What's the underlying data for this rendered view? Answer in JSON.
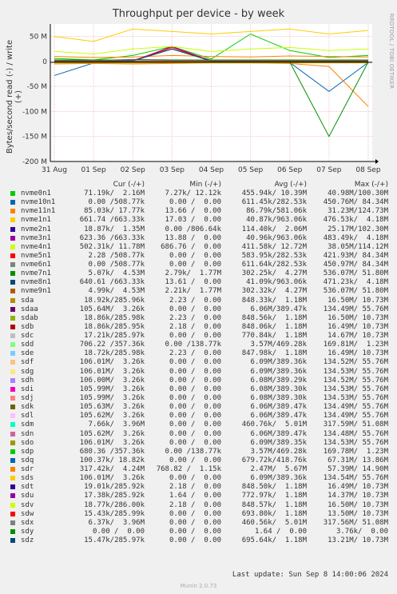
{
  "title": "Throughput per device - by week",
  "ylabel": "Bytes/second read (-) / write (+)",
  "side_label": "RRDTOOL / TOBI OETIKER",
  "footer": "Last update:  Sun Sep  8 14:00:06 2024",
  "version": "Munin 2.0.73",
  "legend_headers": {
    "cur": "Cur (-/+)",
    "min": "Min (-/+)",
    "avg": "Avg (-/+)",
    "max": "Max (-/+)"
  },
  "chart_data": {
    "type": "line",
    "title": "Throughput per device - by week",
    "ylabel": "Bytes/second read (-) / write (+)",
    "ylim": [
      -200,
      75
    ],
    "yunit": "M",
    "yticks": [
      "50 M",
      "0",
      "-50 M",
      "-100 M",
      "-150 M",
      "-200 M"
    ],
    "ytick_values": [
      50,
      0,
      -50,
      -100,
      -150,
      -200
    ],
    "xticks": [
      "31 Aug",
      "01 Sep",
      "02 Sep",
      "03 Sep",
      "04 Sep",
      "05 Sep",
      "06 Sep",
      "07 Sep",
      "08 Sep"
    ],
    "grid": true,
    "x": [
      "31 Aug",
      "01 Sep",
      "02 Sep",
      "03 Sep",
      "04 Sep",
      "05 Sep",
      "06 Sep",
      "07 Sep",
      "08 Sep"
    ],
    "series": [
      {
        "name": "nvme0n1",
        "color": "#00cc00",
        "values": [
          6,
          3,
          12,
          30,
          5,
          55,
          22,
          8,
          12
        ],
        "read": [
          -1,
          -1,
          -1,
          -1,
          -1,
          -2,
          -1,
          -2,
          -1
        ]
      },
      {
        "name": "nvme10n1",
        "color": "#0066b3",
        "values": [
          3,
          2,
          4,
          3,
          2,
          3,
          2,
          3,
          2
        ],
        "read": [
          -28,
          -3,
          -2,
          -2,
          -2,
          -2,
          -2,
          -60,
          -2
        ]
      },
      {
        "name": "nvme11n1",
        "color": "#ff8000",
        "values": [
          10,
          8,
          9,
          12,
          10,
          9,
          11,
          10,
          9
        ],
        "read": [
          -5,
          -4,
          -5,
          -4,
          -3,
          -3,
          -4,
          -10,
          -90
        ]
      },
      {
        "name": "nvme1n1",
        "color": "#ffcc00",
        "values": [
          50,
          40,
          65,
          60,
          55,
          60,
          65,
          55,
          62
        ],
        "read": [
          -3,
          -3,
          -3,
          -3,
          -3,
          -3,
          -3,
          -3,
          -3
        ]
      },
      {
        "name": "nvme2n1",
        "color": "#330099",
        "values": [
          2,
          1,
          2,
          25,
          2,
          2,
          2,
          2,
          2
        ],
        "read": [
          -1,
          -1,
          -1,
          -1,
          -1,
          -1,
          -1,
          -1,
          -1
        ]
      },
      {
        "name": "nvme3n1",
        "color": "#990099",
        "values": [
          1,
          1,
          1,
          30,
          1,
          1,
          1,
          1,
          1
        ],
        "read": [
          0,
          0,
          0,
          0,
          0,
          0,
          0,
          0,
          0
        ]
      },
      {
        "name": "nvme4n1",
        "color": "#ccff00",
        "values": [
          20,
          15,
          25,
          30,
          20,
          25,
          28,
          22,
          25
        ],
        "read": [
          -2,
          -2,
          -2,
          -2,
          -2,
          -2,
          -2,
          -2,
          -2
        ]
      },
      {
        "name": "nvme5n1",
        "color": "#ff0000",
        "values": [
          1,
          1,
          1,
          28,
          1,
          1,
          1,
          1,
          1
        ],
        "read": [
          0,
          0,
          0,
          0,
          0,
          0,
          0,
          0,
          0
        ]
      },
      {
        "name": "nvme6n1",
        "color": "#808080",
        "values": [
          1,
          1,
          1,
          25,
          1,
          1,
          1,
          1,
          1
        ],
        "read": [
          0,
          0,
          0,
          0,
          0,
          0,
          0,
          0,
          0
        ]
      },
      {
        "name": "nvme7n1",
        "color": "#008f00",
        "values": [
          3,
          3,
          3,
          3,
          3,
          3,
          3,
          3,
          3
        ],
        "read": [
          -1,
          -1,
          -1,
          -1,
          -1,
          -1,
          -1,
          -150,
          -1
        ]
      },
      {
        "name": "nvme8n1",
        "color": "#00487d",
        "values": [
          1,
          1,
          1,
          25,
          1,
          1,
          1,
          1,
          1
        ],
        "read": [
          0,
          0,
          0,
          0,
          0,
          0,
          0,
          0,
          0
        ]
      },
      {
        "name": "nvme9n1",
        "color": "#b35a00",
        "values": [
          2,
          2,
          3,
          2,
          2,
          2,
          2,
          2,
          2
        ],
        "read": [
          -1,
          -1,
          -1,
          -1,
          -1,
          -1,
          -1,
          -1,
          -1
        ]
      }
    ]
  },
  "legend": [
    {
      "name": "nvme0n1",
      "color": "#00cc00",
      "cur": "71.19k/  2.16M",
      "min": "7.27k/ 12.12k",
      "avg": "455.94k/ 10.39M",
      "max": "40.98M/100.30M"
    },
    {
      "name": "nvme10n1",
      "color": "#0066b3",
      "cur": "0.00 /508.77k",
      "min": "0.00 /  0.00",
      "avg": "611.45k/282.53k",
      "max": "450.76M/ 84.34M"
    },
    {
      "name": "nvme11n1",
      "color": "#ff8000",
      "cur": "85.03k/ 17.77k",
      "min": "13.66 /  0.00",
      "avg": "86.79k/581.06k",
      "max": "31.23M/124.73M"
    },
    {
      "name": "nvme1n1",
      "color": "#ffcc00",
      "cur": "661.74 /663.33k",
      "min": "17.03 /  0.00",
      "avg": "40.87k/963.06k",
      "max": "476.53k/  4.18M"
    },
    {
      "name": "nvme2n1",
      "color": "#330099",
      "cur": "18.87k/  1.35M",
      "min": "0.00 /806.64k",
      "avg": "114.40k/  2.06M",
      "max": "25.17M/102.30M"
    },
    {
      "name": "nvme3n1",
      "color": "#990099",
      "cur": "623.36 /663.33k",
      "min": "13.88 /  0.00",
      "avg": "40.96k/963.06k",
      "max": "483.49k/  4.18M"
    },
    {
      "name": "nvme4n1",
      "color": "#ccff00",
      "cur": "502.31k/ 11.78M",
      "min": "686.76 /  0.00",
      "avg": "411.58k/ 12.72M",
      "max": "38.05M/114.12M"
    },
    {
      "name": "nvme5n1",
      "color": "#ff0000",
      "cur": "2.28 /508.77k",
      "min": "0.00 /  0.00",
      "avg": "583.95k/282.53k",
      "max": "421.93M/ 84.34M"
    },
    {
      "name": "nvme6n1",
      "color": "#808080",
      "cur": "0.00 /508.77k",
      "min": "0.00 /  0.00",
      "avg": "611.64k/282.53k",
      "max": "450.97M/ 84.34M"
    },
    {
      "name": "nvme7n1",
      "color": "#008f00",
      "cur": "5.07k/  4.53M",
      "min": "2.79k/  1.77M",
      "avg": "302.25k/  4.27M",
      "max": "536.07M/ 51.80M"
    },
    {
      "name": "nvme8n1",
      "color": "#00487d",
      "cur": "640.61 /663.33k",
      "min": "13.61 /  0.00",
      "avg": "41.09k/963.06k",
      "max": "471.23k/  4.18M"
    },
    {
      "name": "nvme9n1",
      "color": "#b35a00",
      "cur": "4.99k/  4.53M",
      "min": "2.21k/  1.77M",
      "avg": "302.32k/  4.27M",
      "max": "536.07M/ 51.80M"
    },
    {
      "name": "sda",
      "color": "#b38f00",
      "cur": "18.92k/285.96k",
      "min": "2.23 /  0.00",
      "avg": "848.33k/  1.18M",
      "max": "16.50M/ 10.73M"
    },
    {
      "name": "sdaa",
      "color": "#6b006b",
      "cur": "105.64M/  3.26k",
      "min": "0.00 /  0.00",
      "avg": "6.06M/389.47k",
      "max": "134.49M/ 55.76M"
    },
    {
      "name": "sdab",
      "color": "#8fb300",
      "cur": "18.86k/285.98k",
      "min": "2.23 /  0.00",
      "avg": "848.56k/  1.18M",
      "max": "16.50M/ 10.73M"
    },
    {
      "name": "sdb",
      "color": "#b30000",
      "cur": "18.86k/285.95k",
      "min": "2.18 /  0.00",
      "avg": "848.06k/  1.18M",
      "max": "16.49M/ 10.73M"
    },
    {
      "name": "sdc",
      "color": "#bebebe",
      "cur": "17.21k/285.97k",
      "min": "0.00 /  0.00",
      "avg": "770.84k/  1.18M",
      "max": "14.67M/ 10.73M"
    },
    {
      "name": "sdd",
      "color": "#80ff80",
      "cur": "706.22 /357.36k",
      "min": "0.00 /138.77k",
      "avg": "3.57M/469.28k",
      "max": "169.81M/  1.23M"
    },
    {
      "name": "sde",
      "color": "#80c9ff",
      "cur": "18.72k/285.98k",
      "min": "2.23 /  0.00",
      "avg": "847.98k/  1.18M",
      "max": "16.49M/ 10.73M"
    },
    {
      "name": "sdf",
      "color": "#ffc080",
      "cur": "106.01M/  3.26k",
      "min": "0.00 /  0.00",
      "avg": "6.09M/389.36k",
      "max": "134.52M/ 55.76M"
    },
    {
      "name": "sdg",
      "color": "#ffe680",
      "cur": "106.01M/  3.26k",
      "min": "0.00 /  0.00",
      "avg": "6.09M/389.36k",
      "max": "134.53M/ 55.76M"
    },
    {
      "name": "sdh",
      "color": "#aa80ff",
      "cur": "106.00M/  3.26k",
      "min": "0.00 /  0.00",
      "avg": "6.08M/389.29k",
      "max": "134.52M/ 55.76M"
    },
    {
      "name": "sdi",
      "color": "#ee00cc",
      "cur": "105.99M/  3.26k",
      "min": "0.00 /  0.00",
      "avg": "6.08M/389.30k",
      "max": "134.53M/ 55.76M"
    },
    {
      "name": "sdj",
      "color": "#ff8080",
      "cur": "105.99M/  3.26k",
      "min": "0.00 /  0.00",
      "avg": "6.08M/389.30k",
      "max": "134.53M/ 55.76M"
    },
    {
      "name": "sdk",
      "color": "#666600",
      "cur": "105.63M/  3.26k",
      "min": "0.00 /  0.00",
      "avg": "6.06M/389.47k",
      "max": "134.49M/ 55.76M"
    },
    {
      "name": "sdl",
      "color": "#ffbfff",
      "cur": "105.62M/  3.26k",
      "min": "0.00 /  0.00",
      "avg": "6.06M/389.47k",
      "max": "134.49M/ 55.76M"
    },
    {
      "name": "sdm",
      "color": "#00ffcc",
      "cur": "7.66k/  3.96M",
      "min": "0.00 /  0.00",
      "avg": "460.76k/  5.01M",
      "max": "317.59M/ 51.08M"
    },
    {
      "name": "sdn",
      "color": "#cc6699",
      "cur": "105.62M/  3.26k",
      "min": "0.00 /  0.00",
      "avg": "6.06M/389.47k",
      "max": "134.48M/ 55.76M"
    },
    {
      "name": "sdo",
      "color": "#999900",
      "cur": "106.01M/  3.26k",
      "min": "0.00 /  0.00",
      "avg": "6.09M/389.35k",
      "max": "134.53M/ 55.76M"
    },
    {
      "name": "sdp",
      "color": "#00cc00",
      "cur": "680.36 /357.36k",
      "min": "0.00 /138.77k",
      "avg": "3.57M/469.28k",
      "max": "169.78M/  1.23M"
    },
    {
      "name": "sdq",
      "color": "#0066b3",
      "cur": "100.37k/ 18.82k",
      "min": "0.00 /  0.00",
      "avg": "679.72k/418.76k",
      "max": "67.31M/ 13.86M"
    },
    {
      "name": "sdr",
      "color": "#ff8000",
      "cur": "317.42k/  4.24M",
      "min": "768.82 /  1.15k",
      "avg": "2.47M/  5.67M",
      "max": "57.39M/ 14.90M"
    },
    {
      "name": "sds",
      "color": "#ffcc00",
      "cur": "106.01M/  3.26k",
      "min": "0.00 /  0.00",
      "avg": "6.09M/389.36k",
      "max": "134.54M/ 55.76M"
    },
    {
      "name": "sdt",
      "color": "#330099",
      "cur": "19.01k/285.92k",
      "min": "2.18 /  0.00",
      "avg": "848.50k/  1.18M",
      "max": "16.49M/ 10.73M"
    },
    {
      "name": "sdu",
      "color": "#990099",
      "cur": "17.38k/285.92k",
      "min": "1.64 /  0.00",
      "avg": "772.97k/  1.18M",
      "max": "14.37M/ 10.73M"
    },
    {
      "name": "sdv",
      "color": "#ccff00",
      "cur": "18.77k/286.00k",
      "min": "2.18 /  0.00",
      "avg": "848.57k/  1.18M",
      "max": "16.50M/ 10.73M"
    },
    {
      "name": "sdw",
      "color": "#ff0000",
      "cur": "15.43k/285.99k",
      "min": "0.00 /  0.00",
      "avg": "693.80k/  1.18M",
      "max": "13.50M/ 10.73M"
    },
    {
      "name": "sdx",
      "color": "#808080",
      "cur": "6.37k/  3.96M",
      "min": "0.00 /  0.00",
      "avg": "460.56k/  5.01M",
      "max": "317.56M/ 51.08M"
    },
    {
      "name": "sdy",
      "color": "#008f00",
      "cur": "0.00 /  0.00",
      "min": "0.00 /  0.00",
      "avg": "1.64 /  0.00",
      "max": "3.76k/  0.00"
    },
    {
      "name": "sdz",
      "color": "#00487d",
      "cur": "15.47k/285.97k",
      "min": "0.00 /  0.00",
      "avg": "695.64k/  1.18M",
      "max": "13.21M/ 10.73M"
    }
  ]
}
